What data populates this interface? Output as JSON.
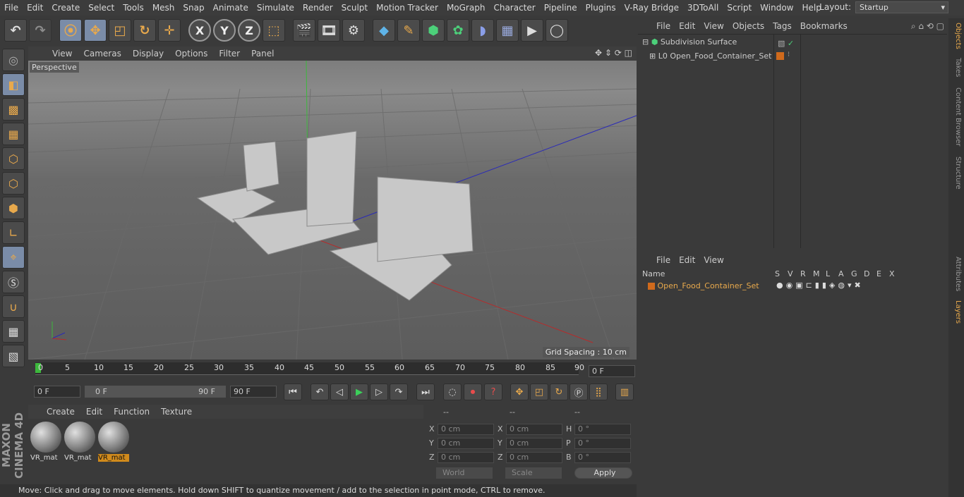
{
  "menubar": {
    "items": [
      "File",
      "Edit",
      "Create",
      "Select",
      "Tools",
      "Mesh",
      "Snap",
      "Animate",
      "Simulate",
      "Render",
      "Sculpt",
      "Motion Tracker",
      "MoGraph",
      "Character",
      "Pipeline",
      "Plugins",
      "V-Ray Bridge",
      "3DToAll",
      "Script",
      "Window",
      "Help"
    ],
    "layout_label": "Layout:",
    "layout_value": "Startup"
  },
  "toolbar": {
    "icons": [
      "undo-icon",
      "redo-icon",
      "live-selection-icon",
      "move-icon",
      "scale-icon",
      "rotate-icon",
      "move-tool-icon",
      "x-axis-icon",
      "y-axis-icon",
      "z-axis-icon",
      "coordinate-system-icon",
      "render-view-icon",
      "render-picture-viewer-icon",
      "render-settings-icon",
      "cube-icon",
      "pen-icon",
      "subdivision-icon",
      "cloner-icon",
      "deformer-icon",
      "floor-icon",
      "camera-icon",
      "light-icon"
    ],
    "axis_x": "X",
    "axis_y": "Y",
    "axis_z": "Z"
  },
  "viewport": {
    "menu": [
      "View",
      "Cameras",
      "Display",
      "Options",
      "Filter",
      "Panel"
    ],
    "title": "Perspective",
    "grid_spacing": "Grid Spacing : 10 cm"
  },
  "timeline": {
    "ticks": [
      "0",
      "5",
      "10",
      "15",
      "20",
      "25",
      "30",
      "35",
      "40",
      "45",
      "50",
      "55",
      "60",
      "65",
      "70",
      "75",
      "80",
      "85",
      "90"
    ],
    "current_frame": "0 F"
  },
  "playbar": {
    "start_frame": "0 F",
    "range_start": "0 F",
    "range_end": "90 F",
    "end_frame": "90 F"
  },
  "material_manager": {
    "menu": [
      "Create",
      "Edit",
      "Function",
      "Texture"
    ],
    "materials": [
      "VR_mat",
      "VR_mat",
      "VR_mat"
    ]
  },
  "coordinates": {
    "headers": [
      "--",
      "--",
      "--"
    ],
    "rows": [
      {
        "a": "X",
        "av": "0 cm",
        "b": "X",
        "bv": "0 cm",
        "c": "H",
        "cv": "0 °"
      },
      {
        "a": "Y",
        "av": "0 cm",
        "b": "Y",
        "bv": "0 cm",
        "c": "P",
        "cv": "0 °"
      },
      {
        "a": "Z",
        "av": "0 cm",
        "b": "Z",
        "bv": "0 cm",
        "c": "B",
        "cv": "0 °"
      }
    ],
    "world": "World",
    "scale": "Scale",
    "apply": "Apply"
  },
  "object_manager": {
    "menu": [
      "File",
      "Edit",
      "View",
      "Objects",
      "Tags",
      "Bookmarks"
    ],
    "objects": [
      "Subdivision Surface",
      "Open_Food_Container_Set"
    ]
  },
  "layer_manager": {
    "menu": [
      "File",
      "Edit",
      "View"
    ],
    "columns": [
      "Name",
      "S",
      "V",
      "R",
      "M",
      "L",
      "A",
      "G",
      "D",
      "E",
      "X"
    ],
    "layers": [
      "Open_Food_Container_Set"
    ]
  },
  "side_tabs": [
    "Objects",
    "Takes",
    "Content Browser",
    "Structure",
    "Attributes",
    "Layers"
  ],
  "status": "Move: Click and drag to move elements. Hold down SHIFT to quantize movement / add to the selection in point mode, CTRL to remove.",
  "brand": "MAXON CINEMA 4D",
  "colors": {
    "accent": "#e8a94c",
    "selected": "#7a8ca8",
    "layer_orange": "#d06a1c"
  }
}
